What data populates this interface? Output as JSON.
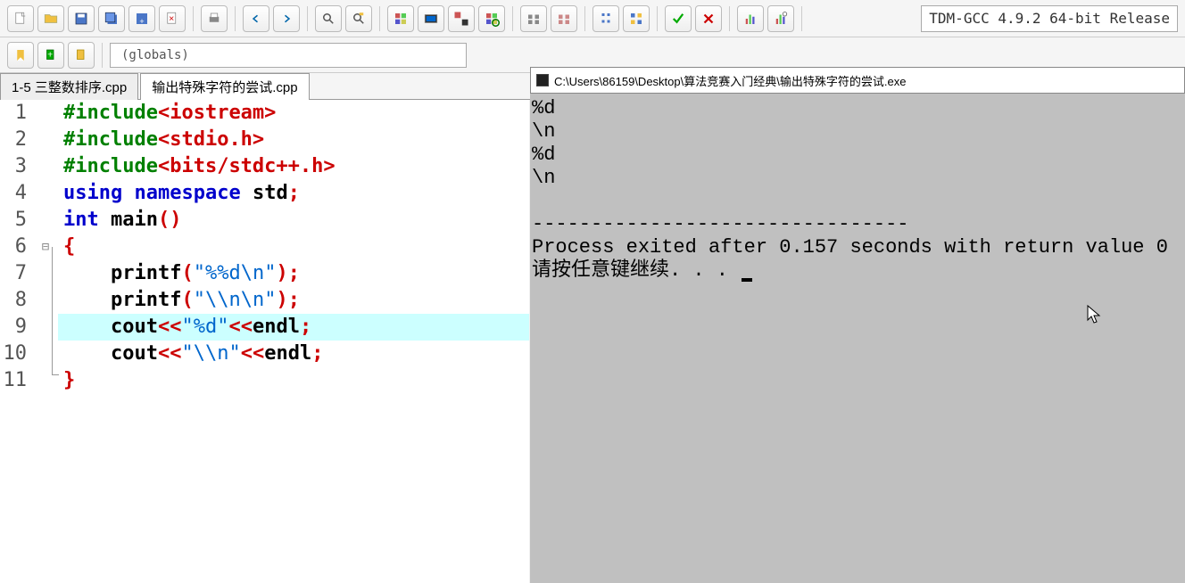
{
  "toolbar": {
    "globals_label": "(globals)"
  },
  "compiler": {
    "label": "TDM-GCC 4.9.2 64-bit Release"
  },
  "tabs": [
    {
      "label": "1-5 三整数排序.cpp",
      "active": false
    },
    {
      "label": "输出特殊字符的尝试.cpp",
      "active": true
    }
  ],
  "code": {
    "lines": [
      {
        "n": 1
      },
      {
        "n": 2
      },
      {
        "n": 3
      },
      {
        "n": 4
      },
      {
        "n": 5
      },
      {
        "n": 6
      },
      {
        "n": 7
      },
      {
        "n": 8
      },
      {
        "n": 9
      },
      {
        "n": 10
      },
      {
        "n": 11
      }
    ],
    "l1": {
      "include": "#include",
      "hdr": "<iostream>"
    },
    "l2": {
      "include": "#include",
      "hdr": "<stdio.h>"
    },
    "l3": {
      "include": "#include",
      "hdr": "<bits/stdc++.h>"
    },
    "l4": {
      "using": "using",
      "ns": "namespace",
      "std": "std",
      "semi": ";"
    },
    "l5": {
      "int": "int",
      "main": "main",
      "paren": "()"
    },
    "l6": {
      "brace": "{"
    },
    "l7": {
      "fn": "printf",
      "open": "(",
      "str": "\"%%d\\n\"",
      "close": ")",
      "semi": ";"
    },
    "l8": {
      "fn": "printf",
      "open": "(",
      "str": "\"\\\\n\\n\"",
      "close": ")",
      "semi": ";"
    },
    "l9": {
      "cout": "cout",
      "lt": "<<",
      "str": "\"%d\"",
      "lt2": "<<",
      "endl": "endl",
      "semi": ";"
    },
    "l10": {
      "cout": "cout",
      "lt": "<<",
      "str": "\"\\\\n\"",
      "lt2": "<<",
      "endl": "endl",
      "semi": ";"
    },
    "l11": {
      "brace": "}"
    }
  },
  "console": {
    "title": "C:\\Users\\86159\\Desktop\\算法竞赛入门经典\\输出特殊字符的尝试.exe",
    "out1": "%d",
    "out2": "\\n",
    "out3": "%d",
    "out4": "\\n",
    "blank": "",
    "dashes": "--------------------------------",
    "exit": "Process exited after 0.157 seconds with return value 0",
    "press": "请按任意键继续. . . "
  },
  "fold_marker": "⊟"
}
